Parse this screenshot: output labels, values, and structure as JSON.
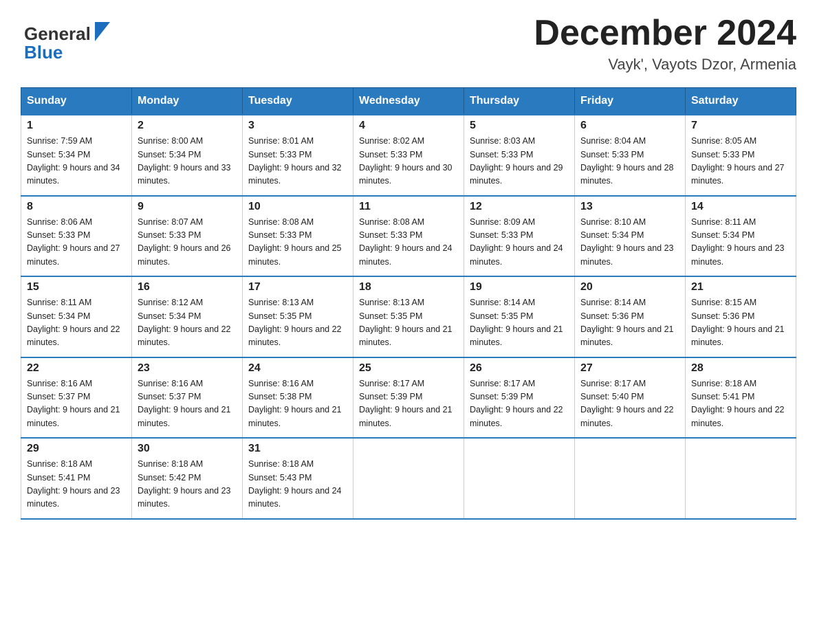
{
  "header": {
    "title": "December 2024",
    "subtitle": "Vayk', Vayots Dzor, Armenia",
    "logo_general": "General",
    "logo_blue": "Blue"
  },
  "weekdays": [
    "Sunday",
    "Monday",
    "Tuesday",
    "Wednesday",
    "Thursday",
    "Friday",
    "Saturday"
  ],
  "weeks": [
    [
      {
        "day": "1",
        "sunrise": "7:59 AM",
        "sunset": "5:34 PM",
        "daylight": "9 hours and 34 minutes."
      },
      {
        "day": "2",
        "sunrise": "8:00 AM",
        "sunset": "5:34 PM",
        "daylight": "9 hours and 33 minutes."
      },
      {
        "day": "3",
        "sunrise": "8:01 AM",
        "sunset": "5:33 PM",
        "daylight": "9 hours and 32 minutes."
      },
      {
        "day": "4",
        "sunrise": "8:02 AM",
        "sunset": "5:33 PM",
        "daylight": "9 hours and 30 minutes."
      },
      {
        "day": "5",
        "sunrise": "8:03 AM",
        "sunset": "5:33 PM",
        "daylight": "9 hours and 29 minutes."
      },
      {
        "day": "6",
        "sunrise": "8:04 AM",
        "sunset": "5:33 PM",
        "daylight": "9 hours and 28 minutes."
      },
      {
        "day": "7",
        "sunrise": "8:05 AM",
        "sunset": "5:33 PM",
        "daylight": "9 hours and 27 minutes."
      }
    ],
    [
      {
        "day": "8",
        "sunrise": "8:06 AM",
        "sunset": "5:33 PM",
        "daylight": "9 hours and 27 minutes."
      },
      {
        "day": "9",
        "sunrise": "8:07 AM",
        "sunset": "5:33 PM",
        "daylight": "9 hours and 26 minutes."
      },
      {
        "day": "10",
        "sunrise": "8:08 AM",
        "sunset": "5:33 PM",
        "daylight": "9 hours and 25 minutes."
      },
      {
        "day": "11",
        "sunrise": "8:08 AM",
        "sunset": "5:33 PM",
        "daylight": "9 hours and 24 minutes."
      },
      {
        "day": "12",
        "sunrise": "8:09 AM",
        "sunset": "5:33 PM",
        "daylight": "9 hours and 24 minutes."
      },
      {
        "day": "13",
        "sunrise": "8:10 AM",
        "sunset": "5:34 PM",
        "daylight": "9 hours and 23 minutes."
      },
      {
        "day": "14",
        "sunrise": "8:11 AM",
        "sunset": "5:34 PM",
        "daylight": "9 hours and 23 minutes."
      }
    ],
    [
      {
        "day": "15",
        "sunrise": "8:11 AM",
        "sunset": "5:34 PM",
        "daylight": "9 hours and 22 minutes."
      },
      {
        "day": "16",
        "sunrise": "8:12 AM",
        "sunset": "5:34 PM",
        "daylight": "9 hours and 22 minutes."
      },
      {
        "day": "17",
        "sunrise": "8:13 AM",
        "sunset": "5:35 PM",
        "daylight": "9 hours and 22 minutes."
      },
      {
        "day": "18",
        "sunrise": "8:13 AM",
        "sunset": "5:35 PM",
        "daylight": "9 hours and 21 minutes."
      },
      {
        "day": "19",
        "sunrise": "8:14 AM",
        "sunset": "5:35 PM",
        "daylight": "9 hours and 21 minutes."
      },
      {
        "day": "20",
        "sunrise": "8:14 AM",
        "sunset": "5:36 PM",
        "daylight": "9 hours and 21 minutes."
      },
      {
        "day": "21",
        "sunrise": "8:15 AM",
        "sunset": "5:36 PM",
        "daylight": "9 hours and 21 minutes."
      }
    ],
    [
      {
        "day": "22",
        "sunrise": "8:16 AM",
        "sunset": "5:37 PM",
        "daylight": "9 hours and 21 minutes."
      },
      {
        "day": "23",
        "sunrise": "8:16 AM",
        "sunset": "5:37 PM",
        "daylight": "9 hours and 21 minutes."
      },
      {
        "day": "24",
        "sunrise": "8:16 AM",
        "sunset": "5:38 PM",
        "daylight": "9 hours and 21 minutes."
      },
      {
        "day": "25",
        "sunrise": "8:17 AM",
        "sunset": "5:39 PM",
        "daylight": "9 hours and 21 minutes."
      },
      {
        "day": "26",
        "sunrise": "8:17 AM",
        "sunset": "5:39 PM",
        "daylight": "9 hours and 22 minutes."
      },
      {
        "day": "27",
        "sunrise": "8:17 AM",
        "sunset": "5:40 PM",
        "daylight": "9 hours and 22 minutes."
      },
      {
        "day": "28",
        "sunrise": "8:18 AM",
        "sunset": "5:41 PM",
        "daylight": "9 hours and 22 minutes."
      }
    ],
    [
      {
        "day": "29",
        "sunrise": "8:18 AM",
        "sunset": "5:41 PM",
        "daylight": "9 hours and 23 minutes."
      },
      {
        "day": "30",
        "sunrise": "8:18 AM",
        "sunset": "5:42 PM",
        "daylight": "9 hours and 23 minutes."
      },
      {
        "day": "31",
        "sunrise": "8:18 AM",
        "sunset": "5:43 PM",
        "daylight": "9 hours and 24 minutes."
      },
      null,
      null,
      null,
      null
    ]
  ]
}
